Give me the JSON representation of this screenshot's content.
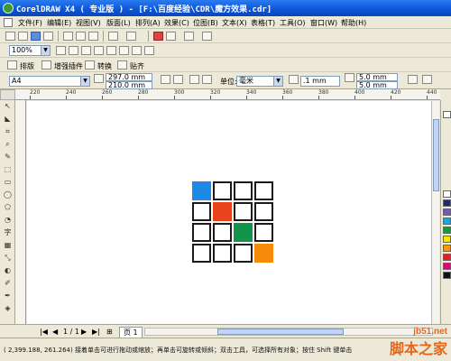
{
  "window": {
    "title": "CorelDRAW X4 ( 专业版 ) - [F:\\百度经验\\CDR\\魔方效果.cdr]"
  },
  "menu": [
    "文件(F)",
    "编辑(E)",
    "视图(V)",
    "版面(L)",
    "排列(A)",
    "效果(C)",
    "位图(B)",
    "文本(X)",
    "表格(T)",
    "工具(O)",
    "窗口(W)",
    "帮助(H)"
  ],
  "toolbar": {
    "zoom": "100%",
    "plugins": [
      "排版",
      "增强插件",
      "转换",
      "贴齐"
    ]
  },
  "property_bar": {
    "page_size": "A4",
    "width": "297.0 mm",
    "height": "210.0 mm",
    "unit_label": "单位:",
    "unit": "毫米",
    "nudge": ".1 mm",
    "dup_x": "5.0 mm",
    "dup_y": "5.0 mm"
  },
  "ruler": {
    "ticks": [
      "220",
      "240",
      "260",
      "280",
      "300",
      "320",
      "340",
      "360",
      "380",
      "400",
      "420",
      "440"
    ]
  },
  "grid": {
    "rows": 4,
    "cols": 4,
    "colored_cells": [
      {
        "row": 0,
        "col": 0,
        "color": "#1e88e5"
      },
      {
        "row": 1,
        "col": 1,
        "color": "#e8431a"
      },
      {
        "row": 2,
        "col": 2,
        "color": "#13944a"
      },
      {
        "row": 3,
        "col": 3,
        "color": "#f58a0b"
      }
    ]
  },
  "palette": [
    "#ffffff",
    "#1e2a6b",
    "#6f5db4",
    "#1aa7e0",
    "#0f9b46",
    "#f5e600",
    "#f59a00",
    "#e31e24",
    "#e5007e",
    "#111111"
  ],
  "page_nav": {
    "counter": "1 / 1",
    "tab": "页 1"
  },
  "status": {
    "coords": "( 2,399.188, 261.264)",
    "hint": "接着单击可进行拖动或缩放；再单击可旋转或倾斜；双击工具，可选择所有对象；按住 Shift 键单击"
  },
  "watermark": {
    "site": "jb51.net",
    "text": "脚本之家"
  }
}
